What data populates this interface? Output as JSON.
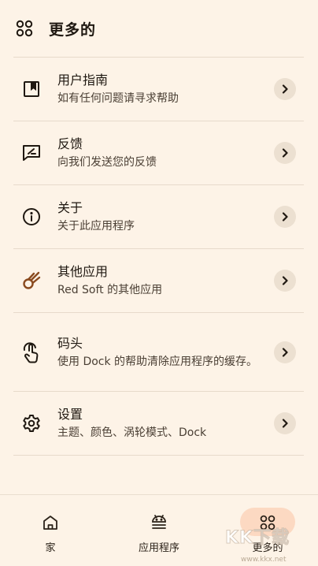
{
  "header": {
    "title": "更多的",
    "icon": "apps-grid-icon"
  },
  "items": [
    {
      "title": "用户指南",
      "subtitle": "如有任何问题请寻求帮助",
      "icon": "book-icon"
    },
    {
      "title": "反馈",
      "subtitle": "向我们发送您的反馈",
      "icon": "feedback-icon"
    },
    {
      "title": "关于",
      "subtitle": "关于此应用程序",
      "icon": "info-icon"
    },
    {
      "title": "其他应用",
      "subtitle": "Red Soft 的其他应用",
      "icon": "comet-icon"
    },
    {
      "title": "码头",
      "subtitle": "使用 Dock 的帮助清除应用程序的缓存。",
      "icon": "touch-icon"
    },
    {
      "title": "设置",
      "subtitle": "主题、颜色、涡轮模式、Dock",
      "icon": "gear-icon"
    }
  ],
  "bottom_nav": [
    {
      "label": "家",
      "icon": "home-icon"
    },
    {
      "label": "应用程序",
      "icon": "android-icon"
    },
    {
      "label": "更多的",
      "icon": "apps-grid-icon",
      "active": true
    }
  ],
  "watermark": {
    "brand": "KK下载",
    "url": "www.kkx.net"
  },
  "colors": {
    "background": "#fdf3e7",
    "active_pill": "#fcd9c2",
    "chevron_bg": "#ece0d1",
    "accent_icon": "#8a4a1f"
  }
}
